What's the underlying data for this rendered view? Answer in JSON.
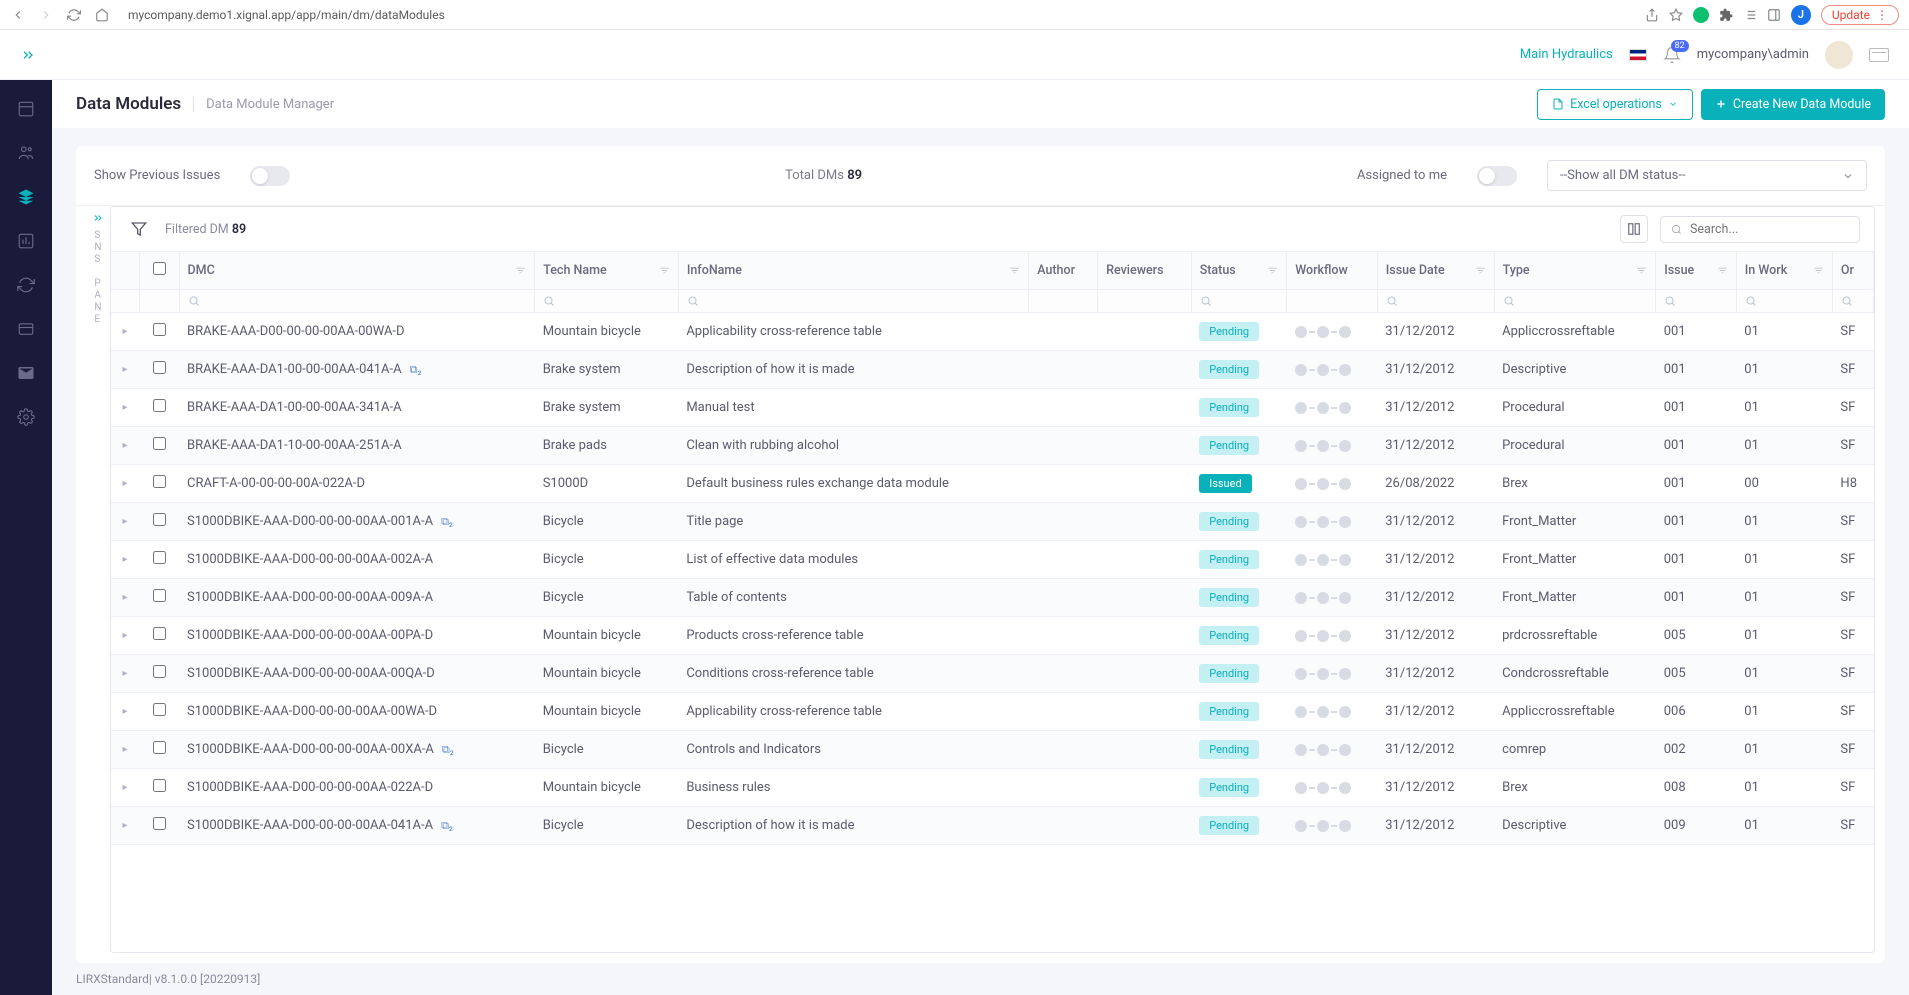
{
  "browser": {
    "url": "mycompany.demo1.xignal.app/app/main/dm/dataModules",
    "avatar_letter": "J",
    "update_label": "Update"
  },
  "topbar": {
    "main_link": "Main Hydraulics",
    "user": "mycompany\\admin",
    "notif_count": "82"
  },
  "page": {
    "title": "Data Modules",
    "subtitle": "Data Module Manager",
    "excel_btn": "Excel operations",
    "create_btn": "Create New Data Module"
  },
  "filters": {
    "prev_issues_label": "Show Previous Issues",
    "total_label": "Total DMs ",
    "total_count": "89",
    "assigned_label": "Assigned to me",
    "status_select": "--Show all DM status--",
    "filtered_label": "Filtered DM ",
    "filtered_count": "89",
    "search_placeholder": "Search..."
  },
  "side_pane_letters": [
    "S",
    "N",
    "S",
    "",
    "P",
    "A",
    "N",
    "E"
  ],
  "columns": [
    "DMC",
    "Tech Name",
    "InfoName",
    "Author",
    "Reviewers",
    "Status",
    "Workflow",
    "Issue Date",
    "Type",
    "Issue",
    "In Work",
    "Or"
  ],
  "rows": [
    {
      "dmc": "BRAKE-AAA-D00-00-00-00AA-00WA-D",
      "copy": false,
      "tech": "Mountain bicycle",
      "info": "Applicability cross-reference table",
      "status": "Pending",
      "date": "31/12/2012",
      "type": "Appliccrossreftable",
      "issue": "001",
      "inwork": "01",
      "or": "SF"
    },
    {
      "dmc": "BRAKE-AAA-DA1-00-00-00AA-041A-A",
      "copy": true,
      "tech": "Brake system",
      "info": "Description of how it is made",
      "status": "Pending",
      "date": "31/12/2012",
      "type": "Descriptive",
      "issue": "001",
      "inwork": "01",
      "or": "SF"
    },
    {
      "dmc": "BRAKE-AAA-DA1-00-00-00AA-341A-A",
      "copy": false,
      "tech": "Brake system",
      "info": "Manual test",
      "status": "Pending",
      "date": "31/12/2012",
      "type": "Procedural",
      "issue": "001",
      "inwork": "01",
      "or": "SF"
    },
    {
      "dmc": "BRAKE-AAA-DA1-10-00-00AA-251A-A",
      "copy": false,
      "tech": "Brake pads",
      "info": "Clean with rubbing alcohol",
      "status": "Pending",
      "date": "31/12/2012",
      "type": "Procedural",
      "issue": "001",
      "inwork": "01",
      "or": "SF"
    },
    {
      "dmc": "CRAFT-A-00-00-00-00A-022A-D",
      "copy": false,
      "tech": "S1000D",
      "info": "Default business rules exchange data module",
      "status": "Issued",
      "date": "26/08/2022",
      "type": "Brex",
      "issue": "001",
      "inwork": "00",
      "or": "H8"
    },
    {
      "dmc": "S1000DBIKE-AAA-D00-00-00-00AA-001A-A",
      "copy": true,
      "tech": "Bicycle",
      "info": "Title page",
      "status": "Pending",
      "date": "31/12/2012",
      "type": "Front_Matter",
      "issue": "001",
      "inwork": "01",
      "or": "SF"
    },
    {
      "dmc": "S1000DBIKE-AAA-D00-00-00-00AA-002A-A",
      "copy": false,
      "tech": "Bicycle",
      "info": "List of effective data modules",
      "status": "Pending",
      "date": "31/12/2012",
      "type": "Front_Matter",
      "issue": "001",
      "inwork": "01",
      "or": "SF"
    },
    {
      "dmc": "S1000DBIKE-AAA-D00-00-00-00AA-009A-A",
      "copy": false,
      "tech": "Bicycle",
      "info": "Table of contents",
      "status": "Pending",
      "date": "31/12/2012",
      "type": "Front_Matter",
      "issue": "001",
      "inwork": "01",
      "or": "SF"
    },
    {
      "dmc": "S1000DBIKE-AAA-D00-00-00-00AA-00PA-D",
      "copy": false,
      "tech": "Mountain bicycle",
      "info": "Products cross-reference table",
      "status": "Pending",
      "date": "31/12/2012",
      "type": "prdcrossreftable",
      "issue": "005",
      "inwork": "01",
      "or": "SF"
    },
    {
      "dmc": "S1000DBIKE-AAA-D00-00-00-00AA-00QA-D",
      "copy": false,
      "tech": "Mountain bicycle",
      "info": "Conditions cross-reference table",
      "status": "Pending",
      "date": "31/12/2012",
      "type": "Condcrossreftable",
      "issue": "005",
      "inwork": "01",
      "or": "SF"
    },
    {
      "dmc": "S1000DBIKE-AAA-D00-00-00-00AA-00WA-D",
      "copy": false,
      "tech": "Mountain bicycle",
      "info": "Applicability cross-reference table",
      "status": "Pending",
      "date": "31/12/2012",
      "type": "Appliccrossreftable",
      "issue": "006",
      "inwork": "01",
      "or": "SF"
    },
    {
      "dmc": "S1000DBIKE-AAA-D00-00-00-00AA-00XA-A",
      "copy": true,
      "tech": "Bicycle",
      "info": "Controls and Indicators",
      "status": "Pending",
      "date": "31/12/2012",
      "type": "comrep",
      "issue": "002",
      "inwork": "01",
      "or": "SF"
    },
    {
      "dmc": "S1000DBIKE-AAA-D00-00-00-00AA-022A-D",
      "copy": false,
      "tech": "Mountain bicycle",
      "info": "Business rules",
      "status": "Pending",
      "date": "31/12/2012",
      "type": "Brex",
      "issue": "008",
      "inwork": "01",
      "or": "SF"
    },
    {
      "dmc": "S1000DBIKE-AAA-D00-00-00-00AA-041A-A",
      "copy": true,
      "tech": "Bicycle",
      "info": "Description of how it is made",
      "status": "Pending",
      "date": "31/12/2012",
      "type": "Descriptive",
      "issue": "009",
      "inwork": "01",
      "or": "SF"
    }
  ],
  "footer": "LIRXStandard| v8.1.0.0 [20220913]"
}
